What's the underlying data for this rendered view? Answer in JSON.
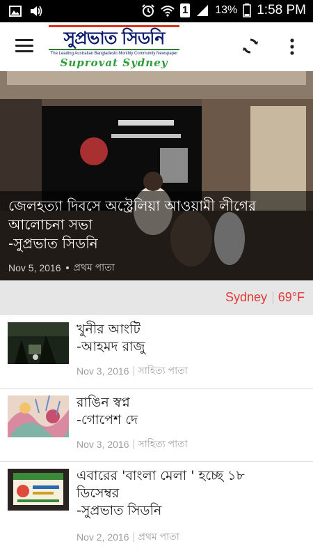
{
  "status_bar": {
    "battery_percent": "13%",
    "sim_badge": "1",
    "time": "1:58 PM"
  },
  "app_bar": {
    "logo": {
      "bangla": "সুপ্রভাত সিডনি",
      "tagline": "The Leading Australian Bangladeshi Monthly Community Newspaper",
      "english": "Suprovat Sydney"
    }
  },
  "hero": {
    "title_line1": "জেলহত্যা দিবসে অস্ট্রেলিয়া আওয়ামী লীগের",
    "title_line2": "আলোচনা সভা",
    "title_line3": "-সুপ্রভাত সিডনি",
    "date": "Nov 5, 2016",
    "category": "প্রথম পাতা"
  },
  "weather": {
    "city": "Sydney",
    "temperature": "69°F"
  },
  "articles": [
    {
      "title_line1": "খুনীর আংটি",
      "title_line2": "-আহমদ রাজু",
      "date": "Nov 3, 2016",
      "category": "সাহিত্য পাতা"
    },
    {
      "title_line1": "রাঙিন স্বপ্ন",
      "title_line2": "-গোপেশ দে",
      "date": "Nov 3, 2016",
      "category": "সাহিত্য পাতা"
    },
    {
      "title_line1": "এবারের 'বাংলা মেলা ' হচ্ছে ১৮",
      "title_line2": "ডিসেম্বর",
      "title_line3": "-সুপ্রভাত সিডনি",
      "date": "Nov 2, 2016",
      "category": "প্রথম পাতা"
    }
  ],
  "icons": {
    "status_left": [
      "gallery-icon",
      "volume-icon"
    ],
    "status_right": [
      "alarm-icon",
      "wifi-icon",
      "signal-icon",
      "battery-icon"
    ],
    "app_bar": [
      "menu-icon",
      "refresh-icon",
      "more-vert-icon"
    ]
  },
  "colors": {
    "accent": "#e53935",
    "status_bar": "#000000",
    "weather_bar": "#e6e6e6"
  }
}
